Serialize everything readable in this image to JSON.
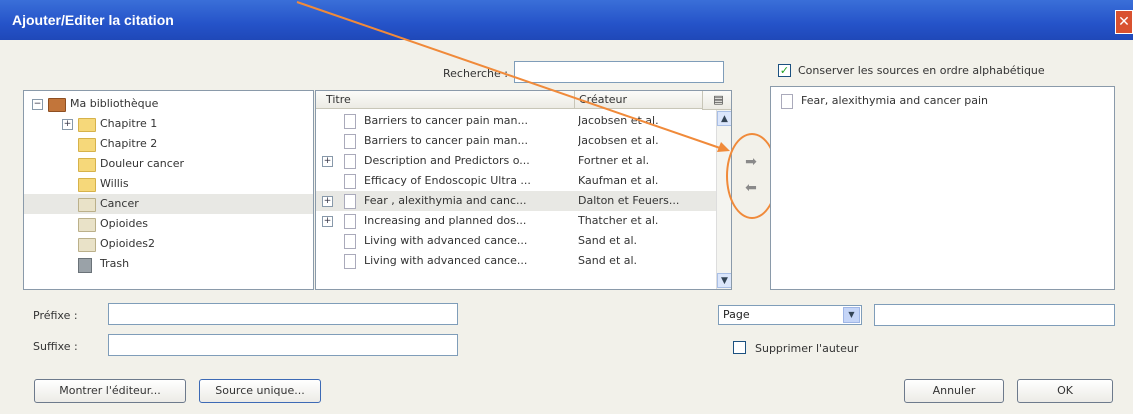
{
  "dialog": {
    "title": "Ajouter/Editer la citation",
    "close_glyph": "✕"
  },
  "search": {
    "label": "Recherche :",
    "value": ""
  },
  "sort_option": {
    "label": "Conserver les sources en ordre alphabétique",
    "checked": true
  },
  "library_tree": [
    {
      "label": "Ma bibliothèque",
      "icon": "library-icon",
      "expander": "−"
    },
    {
      "label": "Chapitre 1",
      "icon": "folder-icon",
      "expander": "+"
    },
    {
      "label": "Chapitre 2",
      "icon": "folder-icon",
      "expander": ""
    },
    {
      "label": "Douleur cancer",
      "icon": "folder-icon",
      "expander": ""
    },
    {
      "label": "Willis",
      "icon": "folder-icon",
      "expander": ""
    },
    {
      "label": "Cancer",
      "icon": "saved-search-icon",
      "expander": "",
      "selected": true
    },
    {
      "label": "Opioides",
      "icon": "saved-search-icon",
      "expander": ""
    },
    {
      "label": "Opioides2",
      "icon": "saved-search-icon",
      "expander": ""
    },
    {
      "label": "Trash",
      "icon": "trash-icon",
      "expander": ""
    }
  ],
  "items_table": {
    "columns": [
      "Titre",
      "Créateur"
    ],
    "rows": [
      {
        "title": "Barriers to cancer pain man...",
        "creator": "Jacobsen et al.",
        "expander": ""
      },
      {
        "title": "Barriers to cancer pain man...",
        "creator": "Jacobsen et al.",
        "expander": ""
      },
      {
        "title": "Description and Predictors o...",
        "creator": "Fortner et al.",
        "expander": "+"
      },
      {
        "title": "Efficacy of Endoscopic Ultra ...",
        "creator": "Kaufman et al.",
        "expander": ""
      },
      {
        "title": "Fear , alexithymia and canc...",
        "creator": "Dalton et Feuers...",
        "expander": "+",
        "selected": true
      },
      {
        "title": "Increasing and planned dos...",
        "creator": "Thatcher et al.",
        "expander": "+"
      },
      {
        "title": "Living with advanced cance...",
        "creator": "Sand et al.",
        "expander": ""
      },
      {
        "title": "Living with advanced cance...",
        "creator": "Sand et al.",
        "expander": ""
      }
    ]
  },
  "selected_sources": [
    {
      "title": "Fear, alexithymia and cancer pain"
    }
  ],
  "move_buttons": {
    "add_glyph": "➡",
    "remove_glyph": "⬅"
  },
  "prefix": {
    "label": "Préfixe :",
    "value": ""
  },
  "suffix": {
    "label": "Suffixe :",
    "value": ""
  },
  "locator": {
    "selected": "Page",
    "value": ""
  },
  "suppress_author": {
    "label": "Supprimer l'auteur",
    "checked": false
  },
  "buttons": {
    "show_editor": "Montrer l'éditeur...",
    "single_source": "Source unique...",
    "cancel": "Annuler",
    "ok": "OK"
  },
  "colors": {
    "titlebar": "#2553c9",
    "annotation": "#f08a3a",
    "close": "#d9512f"
  }
}
